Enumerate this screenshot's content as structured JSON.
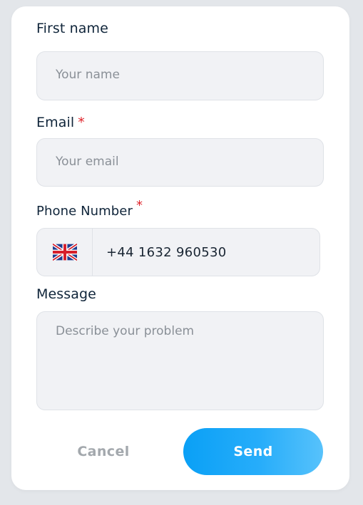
{
  "form": {
    "first_name": {
      "label": "First name",
      "placeholder": "Your name"
    },
    "email": {
      "label": "Email",
      "required_mark": "*",
      "placeholder": "Your email"
    },
    "phone": {
      "label": "Phone Number",
      "required_mark": "*",
      "country_icon": "uk-flag-icon",
      "value": "+44 1632 960530"
    },
    "message": {
      "label": "Message",
      "placeholder": "Describe your problem"
    }
  },
  "actions": {
    "cancel_label": "Cancel",
    "send_label": "Send"
  },
  "colors": {
    "accent": "#0aa0f6",
    "required": "#e0242b",
    "label": "#10253a",
    "field_bg": "#f1f2f5"
  }
}
